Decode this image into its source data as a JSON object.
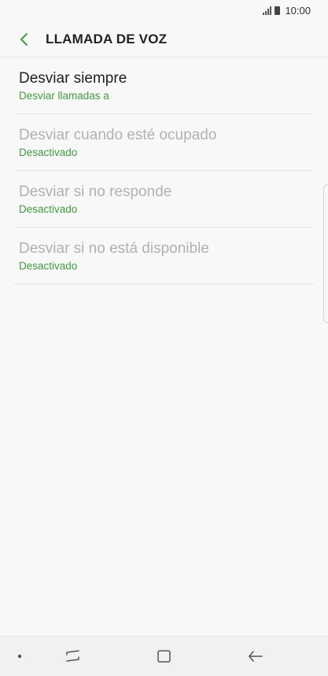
{
  "status_bar": {
    "time": "10:00"
  },
  "header": {
    "title": "LLAMADA DE VOZ"
  },
  "items": [
    {
      "title": "Desviar siempre",
      "subtitle": "Desviar llamadas a",
      "enabled": true
    },
    {
      "title": "Desviar cuando esté ocupado",
      "subtitle": "Desactivado",
      "enabled": false
    },
    {
      "title": "Desviar si no responde",
      "subtitle": "Desactivado",
      "enabled": false
    },
    {
      "title": "Desviar si no está disponible",
      "subtitle": "Desactivado",
      "enabled": false
    }
  ],
  "colors": {
    "accent": "#3e9c3e",
    "title_enabled": "#1f1f1f",
    "title_disabled": "#b1b1b1",
    "background": "#f8f8f8"
  },
  "nav_bar": {
    "icons": [
      "dot-icon",
      "recent-apps-icon",
      "home-icon",
      "back-arrow-icon"
    ]
  }
}
